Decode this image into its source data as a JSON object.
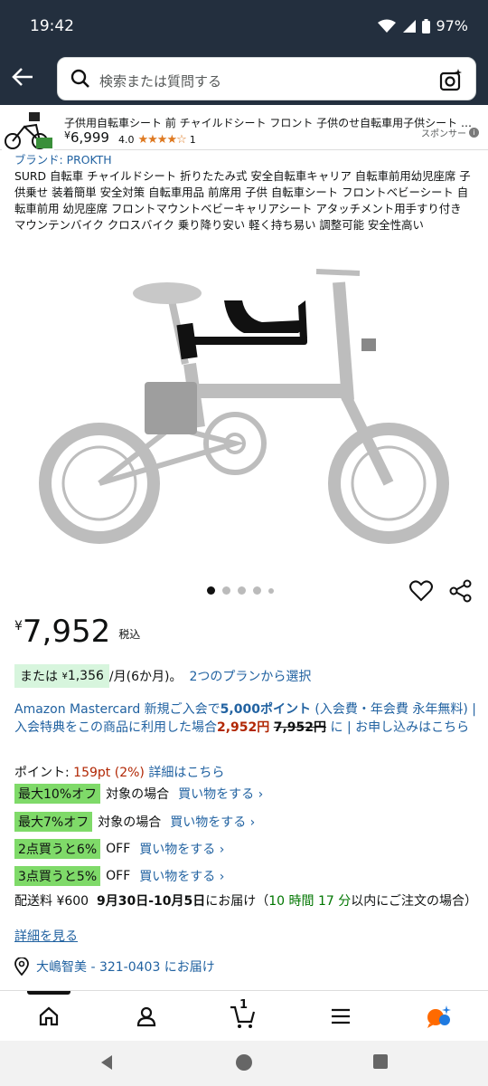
{
  "status": {
    "time": "19:42",
    "battery": "97%"
  },
  "search": {
    "placeholder": "検索または質問する"
  },
  "sponsored": {
    "title": "子供用自転車シート 前 チャイルドシート フロント 子供のせ自転車用子供シート マウン…",
    "currency": "¥",
    "price": "6,999",
    "rating": "4.0",
    "stars": "★★★★☆",
    "review_count": "1",
    "label": "スポンサー"
  },
  "product": {
    "brand": "ブランド: PROKTH",
    "title": "SURD 自転車 チャイルドシート 折りたたみ式 安全自転車キャリア 自転車前用幼児座席 子供乗せ 装着簡単 安全対策 自転車用品 前席用 子供 自転車シート フロントベビーシート 自転車前用 幼児座席 フロントマウントベビーキャリアシート アタッチメント用手すり付き マウンテンバイク クロスバイク 乗り降り安い 軽く持ち易い 調整可能 安全性高い",
    "image_alt": "bicycle-with-child-seat"
  },
  "price": {
    "currency": "¥",
    "amount": "7,952",
    "tax": "税込"
  },
  "installment": {
    "prefix": "または",
    "currency": "¥",
    "amount": "1,356",
    "period": "/月(6か月)。",
    "link": "2つのプランから選択"
  },
  "card_promo": {
    "part1": "Amazon Mastercard 新規ご入会で",
    "points": "5,000ポイント",
    "part2": " (入会費・年会費 永年無料) | 入会特典をこの商品に利用した場合",
    "discounted": "2,952円",
    "original": "7,952円",
    "part3": " に | お申し込みはこちら"
  },
  "points": {
    "label": "ポイント: ",
    "value": "159pt",
    "percent": "(2%)",
    "link": "詳細はこちら"
  },
  "offers": [
    {
      "badge": "最大10%オフ",
      "text": "対象の場合",
      "link": "買い物をする ›"
    },
    {
      "badge": "最大7%オフ",
      "text": "対象の場合",
      "link": "買い物をする ›"
    },
    {
      "badge": "2点買うと6%",
      "text": "OFF",
      "link": "買い物をする ›"
    },
    {
      "badge": "3点買うと5%",
      "text": "OFF",
      "link": "買い物をする ›"
    }
  ],
  "shipping": {
    "fee": "配送料 ¥600",
    "dates": "9月30日-10月5日",
    "mid": "にお届け（",
    "countdown": "10 時間 17 分",
    "tail": "以内にご注文の場合）",
    "details_link": "詳細を見る"
  },
  "deliver_to": "大嶋智美 - 321-0403 にお届け",
  "bottom_nav": {
    "cart_count": "1"
  },
  "colors": {
    "header": "#232f3e",
    "link": "#2162a1",
    "price_red": "#b12704",
    "badge_green": "#7fda69",
    "installment_bg": "#d7f5dd"
  }
}
